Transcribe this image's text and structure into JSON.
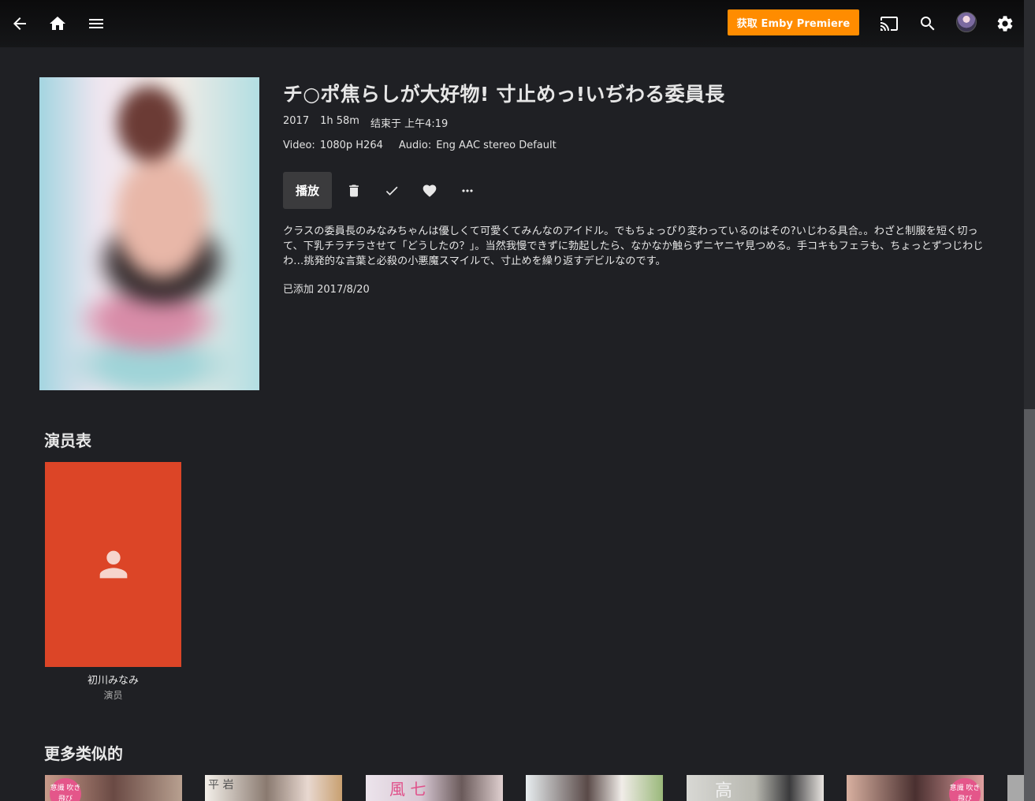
{
  "topbar": {
    "back_icon": "arrow-left-icon",
    "home_icon": "home-icon",
    "menu_icon": "hamburger-menu-icon",
    "premiere_label": "获取 Emby Premiere",
    "premiere_color": "#ff8c00",
    "cast_icon": "cast-icon",
    "search_icon": "search-icon",
    "avatar_icon": "user-avatar",
    "settings_icon": "gear-icon"
  },
  "item": {
    "title": "チ○ポ焦らしが大好物! 寸止めっ!いぢわる委員長",
    "year": "2017",
    "runtime": "1h 58m",
    "ends_at": "结束于 上午4:19",
    "video_label": "Video:",
    "video_value": "1080p H264",
    "audio_label": "Audio:",
    "audio_value": "Eng AAC stereo Default",
    "play_label": "播放",
    "overview": "クラスの委員長のみなみちゃんは優しくて可愛くてみんなのアイドル。でもちょっぴり変わっているのはその?いじわる具合。。わざと制服を短く切って、下乳チラチラさせて「どうしたの？」。当然我慢できずに勃起したら、なかなか触らずニヤニヤ見つめる。手コキもフェラも、ちょっとずつじわじわ…挑発的な言葉と必殺の小悪魔スマイルで、寸止めを繰り返すデビルなのです。",
    "added": "已添加 2017/8/20"
  },
  "actions": {
    "delete_icon": "trash-icon",
    "watched_icon": "check-icon",
    "favorite_icon": "heart-icon",
    "more_icon": "more-horizontal-icon"
  },
  "cast": {
    "heading": "演员表",
    "card_color": "#dc4527",
    "people": [
      {
        "name": "初川みなみ",
        "role": "演员",
        "icon": "person-icon"
      }
    ]
  },
  "similar": {
    "heading": "更多类似的",
    "items": [
      {
        "badge": "意識 吹き飛び"
      },
      {
        "text": "平 岩"
      },
      {
        "text": "風 七"
      },
      {
        "text": ""
      },
      {
        "text": "高"
      },
      {
        "badge": "意識 吹き飛び"
      }
    ]
  }
}
